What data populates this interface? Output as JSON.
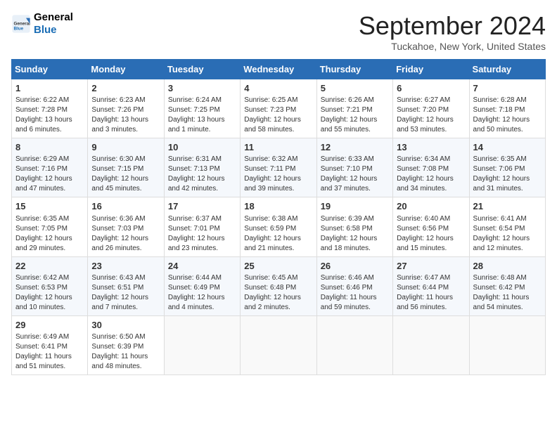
{
  "logo": {
    "line1": "General",
    "line2": "Blue"
  },
  "title": "September 2024",
  "location": "Tuckahoe, New York, United States",
  "headers": [
    "Sunday",
    "Monday",
    "Tuesday",
    "Wednesday",
    "Thursday",
    "Friday",
    "Saturday"
  ],
  "weeks": [
    [
      {
        "day": "1",
        "info": "Sunrise: 6:22 AM\nSunset: 7:28 PM\nDaylight: 13 hours\nand 6 minutes."
      },
      {
        "day": "2",
        "info": "Sunrise: 6:23 AM\nSunset: 7:26 PM\nDaylight: 13 hours\nand 3 minutes."
      },
      {
        "day": "3",
        "info": "Sunrise: 6:24 AM\nSunset: 7:25 PM\nDaylight: 13 hours\nand 1 minute."
      },
      {
        "day": "4",
        "info": "Sunrise: 6:25 AM\nSunset: 7:23 PM\nDaylight: 12 hours\nand 58 minutes."
      },
      {
        "day": "5",
        "info": "Sunrise: 6:26 AM\nSunset: 7:21 PM\nDaylight: 12 hours\nand 55 minutes."
      },
      {
        "day": "6",
        "info": "Sunrise: 6:27 AM\nSunset: 7:20 PM\nDaylight: 12 hours\nand 53 minutes."
      },
      {
        "day": "7",
        "info": "Sunrise: 6:28 AM\nSunset: 7:18 PM\nDaylight: 12 hours\nand 50 minutes."
      }
    ],
    [
      {
        "day": "8",
        "info": "Sunrise: 6:29 AM\nSunset: 7:16 PM\nDaylight: 12 hours\nand 47 minutes."
      },
      {
        "day": "9",
        "info": "Sunrise: 6:30 AM\nSunset: 7:15 PM\nDaylight: 12 hours\nand 45 minutes."
      },
      {
        "day": "10",
        "info": "Sunrise: 6:31 AM\nSunset: 7:13 PM\nDaylight: 12 hours\nand 42 minutes."
      },
      {
        "day": "11",
        "info": "Sunrise: 6:32 AM\nSunset: 7:11 PM\nDaylight: 12 hours\nand 39 minutes."
      },
      {
        "day": "12",
        "info": "Sunrise: 6:33 AM\nSunset: 7:10 PM\nDaylight: 12 hours\nand 37 minutes."
      },
      {
        "day": "13",
        "info": "Sunrise: 6:34 AM\nSunset: 7:08 PM\nDaylight: 12 hours\nand 34 minutes."
      },
      {
        "day": "14",
        "info": "Sunrise: 6:35 AM\nSunset: 7:06 PM\nDaylight: 12 hours\nand 31 minutes."
      }
    ],
    [
      {
        "day": "15",
        "info": "Sunrise: 6:35 AM\nSunset: 7:05 PM\nDaylight: 12 hours\nand 29 minutes."
      },
      {
        "day": "16",
        "info": "Sunrise: 6:36 AM\nSunset: 7:03 PM\nDaylight: 12 hours\nand 26 minutes."
      },
      {
        "day": "17",
        "info": "Sunrise: 6:37 AM\nSunset: 7:01 PM\nDaylight: 12 hours\nand 23 minutes."
      },
      {
        "day": "18",
        "info": "Sunrise: 6:38 AM\nSunset: 6:59 PM\nDaylight: 12 hours\nand 21 minutes."
      },
      {
        "day": "19",
        "info": "Sunrise: 6:39 AM\nSunset: 6:58 PM\nDaylight: 12 hours\nand 18 minutes."
      },
      {
        "day": "20",
        "info": "Sunrise: 6:40 AM\nSunset: 6:56 PM\nDaylight: 12 hours\nand 15 minutes."
      },
      {
        "day": "21",
        "info": "Sunrise: 6:41 AM\nSunset: 6:54 PM\nDaylight: 12 hours\nand 12 minutes."
      }
    ],
    [
      {
        "day": "22",
        "info": "Sunrise: 6:42 AM\nSunset: 6:53 PM\nDaylight: 12 hours\nand 10 minutes."
      },
      {
        "day": "23",
        "info": "Sunrise: 6:43 AM\nSunset: 6:51 PM\nDaylight: 12 hours\nand 7 minutes."
      },
      {
        "day": "24",
        "info": "Sunrise: 6:44 AM\nSunset: 6:49 PM\nDaylight: 12 hours\nand 4 minutes."
      },
      {
        "day": "25",
        "info": "Sunrise: 6:45 AM\nSunset: 6:48 PM\nDaylight: 12 hours\nand 2 minutes."
      },
      {
        "day": "26",
        "info": "Sunrise: 6:46 AM\nSunset: 6:46 PM\nDaylight: 11 hours\nand 59 minutes."
      },
      {
        "day": "27",
        "info": "Sunrise: 6:47 AM\nSunset: 6:44 PM\nDaylight: 11 hours\nand 56 minutes."
      },
      {
        "day": "28",
        "info": "Sunrise: 6:48 AM\nSunset: 6:42 PM\nDaylight: 11 hours\nand 54 minutes."
      }
    ],
    [
      {
        "day": "29",
        "info": "Sunrise: 6:49 AM\nSunset: 6:41 PM\nDaylight: 11 hours\nand 51 minutes."
      },
      {
        "day": "30",
        "info": "Sunrise: 6:50 AM\nSunset: 6:39 PM\nDaylight: 11 hours\nand 48 minutes."
      },
      null,
      null,
      null,
      null,
      null
    ]
  ]
}
